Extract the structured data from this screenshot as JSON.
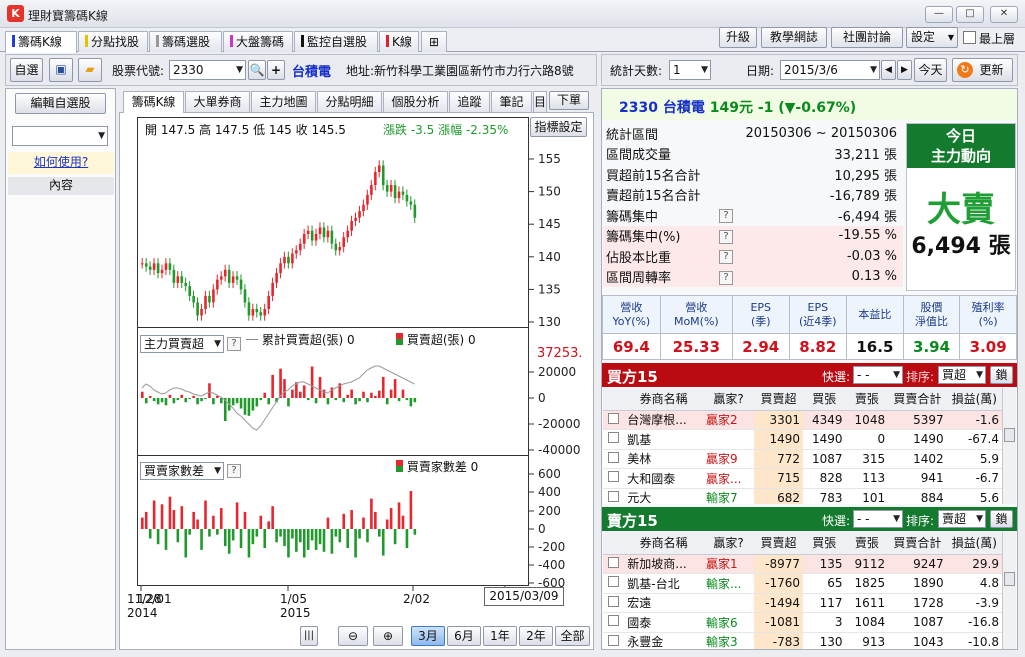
{
  "window": {
    "title": "理財寶籌碼K線"
  },
  "top_tabs": [
    {
      "label": "籌碼K線",
      "color": "#1f3fd6"
    },
    {
      "label": "分點找股",
      "color": "#e6c200"
    },
    {
      "label": "籌碼選股",
      "color": "#999999"
    },
    {
      "label": "大盤籌碼",
      "color": "#cc33cc"
    },
    {
      "label": "監控自選股",
      "color": "#111111"
    },
    {
      "label": "K線",
      "color": "#e0202a"
    }
  ],
  "top_buttons": {
    "upgrade": "升級",
    "teaching": "教學網誌",
    "forum": "社團討論",
    "settings": "設定",
    "topmost": "最上層"
  },
  "toolbar": {
    "watchlist_btn": "自選",
    "stock_code_label": "股票代號:",
    "stock_code_value": "2330",
    "stock_name": "台積電",
    "address": "地址:新竹科學工業園區新竹市力行六路8號",
    "days_label": "統計天數:",
    "days_value": "1",
    "date_label": "日期:",
    "date_value": "2015/3/6",
    "today_btn": "今天",
    "refresh_btn": "更新"
  },
  "sidebar": {
    "edit_btn": "編輯自選股",
    "how_to": "如何使用?",
    "content": "內容"
  },
  "chart_tabs": [
    "籌碼K線",
    "大單券商",
    "主力地圖",
    "分點明細",
    "個股分析",
    "追蹤",
    "筆記",
    "目"
  ],
  "chart_tab_more": "下單",
  "indicator_btn": "指標設定",
  "ohlc": {
    "open_label": "開",
    "open": "147.5",
    "high_label": "高",
    "high": "147.5",
    "low_label": "低",
    "low": "145",
    "close_label": "收",
    "close": "145.5",
    "change_label": "漲跌",
    "change": "-3.5",
    "pct_label": "漲幅",
    "pct": "-2.35%"
  },
  "price_axis": [
    "155",
    "150",
    "145",
    "140",
    "135",
    "130"
  ],
  "sub1": {
    "select": "主力買賣超",
    "legend_cum": "累計買賣超(張) 0",
    "legend_bar": "買賣超(張) 0",
    "max_label": "37253.",
    "axis": [
      "20000",
      "0",
      "-20000",
      "-40000"
    ]
  },
  "sub2": {
    "select": "買賣家數差",
    "legend_bar": "買賣家數差 0",
    "axis": [
      "600",
      "400",
      "200",
      "0",
      "-200",
      "-400",
      "-600"
    ]
  },
  "x_axis": [
    {
      "t": "11/28",
      "s": "2014"
    },
    {
      "t": "1/05",
      "s": "2015"
    },
    {
      "t": "2/02",
      "s": ""
    }
  ],
  "x_axis_overlap": "12/01",
  "tooltip_date": "2015/03/09",
  "range_buttons": [
    "3月",
    "6月",
    "1年",
    "2年",
    "全部"
  ],
  "range_active": "3月",
  "quote": {
    "code": "2330",
    "name": "台積電",
    "price": "149元",
    "change": "-1",
    "pct": "(▼-0.67%)"
  },
  "stats": [
    {
      "label": "統計區間",
      "value": "20150306 ~ 20150306",
      "q": false,
      "hl": false
    },
    {
      "label": "區間成交量",
      "value": "33,211 張",
      "q": false,
      "hl": false
    },
    {
      "label": "買超前15名合計",
      "value": "10,295 張",
      "q": false,
      "hl": false
    },
    {
      "label": "賣超前15名合計",
      "value": "-16,789 張",
      "q": false,
      "hl": false
    },
    {
      "label": "籌碼集中",
      "value": "-6,494 張",
      "q": true,
      "hl": false
    },
    {
      "label": "籌碼集中(%)",
      "value": "-19.55 %",
      "q": true,
      "hl": true
    },
    {
      "label": "佔股本比重",
      "value": "-0.03 %",
      "q": true,
      "hl": true
    },
    {
      "label": "區間周轉率",
      "value": "0.13 %",
      "q": true,
      "hl": true
    }
  ],
  "main_force": {
    "title1": "今日",
    "title2": "主力動向",
    "verdict": "大賣",
    "amount": "6,494 張"
  },
  "fin_headers": [
    "營收\nYoY(%)",
    "營收\nMoM(%)",
    "EPS\n(季)",
    "EPS\n(近4季)",
    "本益比",
    "股價\n淨值比",
    "殖利率\n(%)"
  ],
  "fin_values": [
    {
      "v": "69.4",
      "c": "#d0101a"
    },
    {
      "v": "25.33",
      "c": "#d0101a"
    },
    {
      "v": "2.94",
      "c": "#d0101a"
    },
    {
      "v": "8.82",
      "c": "#d0101a"
    },
    {
      "v": "16.5",
      "c": "#111111"
    },
    {
      "v": "3.94",
      "c": "#0a8a1c"
    },
    {
      "v": "3.09",
      "c": "#d0101a"
    }
  ],
  "buy": {
    "title": "買方15",
    "quick_label": "快選:",
    "quick_value": "- -",
    "sort_label": "排序:",
    "sort_value": "買超",
    "lock": "鎖",
    "headers": [
      "券商名稱",
      "贏家?",
      "買賣超",
      "買張",
      "賣張",
      "買賣合計",
      "損益(萬)"
    ],
    "rows": [
      {
        "name": "台灣摩根...",
        "winner": "贏家2",
        "wc": "#c81414",
        "net": "3301",
        "buy": "4349",
        "sell": "1048",
        "total": "5397",
        "pl": "-1.6"
      },
      {
        "name": "凱基",
        "winner": "",
        "wc": "#c81414",
        "net": "1490",
        "buy": "1490",
        "sell": "0",
        "total": "1490",
        "pl": "-67.4"
      },
      {
        "name": "美林",
        "winner": "贏家9",
        "wc": "#c81414",
        "net": "772",
        "buy": "1087",
        "sell": "315",
        "total": "1402",
        "pl": "5.9"
      },
      {
        "name": "大和國泰",
        "winner": "贏家...",
        "wc": "#c81414",
        "net": "715",
        "buy": "828",
        "sell": "113",
        "total": "941",
        "pl": "-6.7"
      },
      {
        "name": "元大",
        "winner": "輸家7",
        "wc": "#0a8a1c",
        "net": "682",
        "buy": "783",
        "sell": "101",
        "total": "884",
        "pl": "5.6"
      }
    ]
  },
  "sell": {
    "title": "賣方15",
    "quick_label": "快選:",
    "quick_value": "- -",
    "sort_label": "排序:",
    "sort_value": "賣超",
    "lock": "鎖",
    "headers": [
      "券商名稱",
      "贏家?",
      "買賣超",
      "買張",
      "賣張",
      "買賣合計",
      "損益(萬)"
    ],
    "rows": [
      {
        "name": "新加坡商...",
        "winner": "贏家1",
        "wc": "#c81414",
        "net": "-8977",
        "buy": "135",
        "sell": "9112",
        "total": "9247",
        "pl": "29.9"
      },
      {
        "name": "凱基-台北",
        "winner": "輸家...",
        "wc": "#0a8a1c",
        "net": "-1760",
        "buy": "65",
        "sell": "1825",
        "total": "1890",
        "pl": "4.8"
      },
      {
        "name": "宏遠",
        "winner": "",
        "wc": "#0a8a1c",
        "net": "-1494",
        "buy": "117",
        "sell": "1611",
        "total": "1728",
        "pl": "-3.9"
      },
      {
        "name": "國泰",
        "winner": "輸家6",
        "wc": "#0a8a1c",
        "net": "-1081",
        "buy": "3",
        "sell": "1084",
        "total": "1087",
        "pl": "-16.8"
      },
      {
        "name": "永豐金",
        "winner": "輸家3",
        "wc": "#0a8a1c",
        "net": "-783",
        "buy": "130",
        "sell": "913",
        "total": "1043",
        "pl": "-10.8"
      }
    ]
  },
  "colors": {
    "up": "#e8262e",
    "down": "#1f9a2b",
    "buy_header": "#bb0b12",
    "sell_header": "#147a2e"
  }
}
